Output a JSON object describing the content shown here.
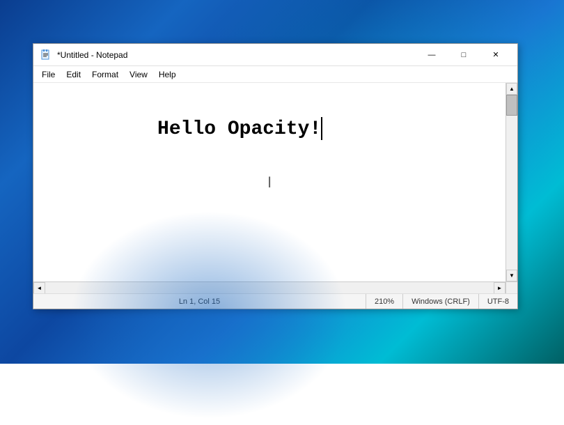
{
  "desktop": {
    "background_desc": "Windows 11 blue swirl wallpaper"
  },
  "window": {
    "title": "*Untitled - Notepad",
    "app_icon": "notepad"
  },
  "title_bar": {
    "title": "*Untitled - Notepad",
    "minimize_label": "—",
    "maximize_label": "□",
    "close_label": "✕"
  },
  "menu_bar": {
    "items": [
      {
        "id": "file",
        "label": "File"
      },
      {
        "id": "edit",
        "label": "Edit"
      },
      {
        "id": "format",
        "label": "Format"
      },
      {
        "id": "view",
        "label": "View"
      },
      {
        "id": "help",
        "label": "Help"
      }
    ]
  },
  "editor": {
    "content": "Hello Opacity!",
    "font": "Courier New",
    "font_size": "28px bold"
  },
  "status_bar": {
    "position": "Ln 1, Col 15",
    "zoom": "210%",
    "line_ending": "Windows (CRLF)",
    "encoding": "UTF-8"
  },
  "scrollbar": {
    "up_arrow": "▲",
    "down_arrow": "▼",
    "left_arrow": "◄",
    "right_arrow": "►"
  }
}
